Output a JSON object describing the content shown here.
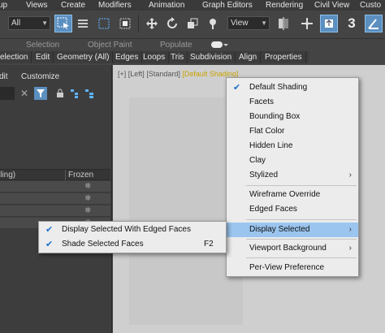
{
  "menubar": {
    "items": [
      "up",
      "Views",
      "Create",
      "Modifiers",
      "Animation",
      "Graph Editors",
      "Rendering",
      "Civil View",
      "Custo"
    ]
  },
  "toolbar": {
    "filter_value": "All",
    "viewport_dropdown_value": "View",
    "snap_label": "3"
  },
  "ribbon": {
    "labels": [
      "Selection",
      "Object Paint",
      "Populate"
    ]
  },
  "tabs": {
    "items": [
      "election",
      "Edit",
      "Geometry (All)",
      "Edges",
      "Loops",
      "Tris",
      "Subdivision",
      "Align",
      "Properties"
    ]
  },
  "left_panel": {
    "menu": [
      "dit",
      "Customize"
    ],
    "column_left": "lling)",
    "column_frozen": "Frozen",
    "row_marker": "❅"
  },
  "viewport": {
    "label_parts": [
      "[+]",
      "[Left]",
      "[Standard]"
    ],
    "shading_label": "[Default Shading]",
    "label_close": "]"
  },
  "shading_menu": {
    "items": [
      {
        "label": "Default Shading",
        "checked": true
      },
      {
        "label": "Facets"
      },
      {
        "label": "Bounding Box"
      },
      {
        "label": "Flat Color"
      },
      {
        "label": "Hidden Line"
      },
      {
        "label": "Clay"
      },
      {
        "label": "Stylized",
        "submenu": true
      },
      {
        "label": "Wireframe Override"
      },
      {
        "label": "Edged Faces"
      },
      {
        "label": "Display Selected",
        "submenu": true,
        "highlighted": true
      },
      {
        "label": "Viewport Background",
        "submenu": true
      },
      {
        "label": "Per-View Preference"
      }
    ]
  },
  "display_selected_menu": {
    "items": [
      {
        "label": "Display Selected With Edged Faces",
        "checked": true,
        "shortcut": ""
      },
      {
        "label": "Shade Selected Faces",
        "checked": true,
        "shortcut": "F2"
      }
    ]
  },
  "colors": {
    "accent": "#5b8fc0",
    "menu_bg": "#ececec",
    "highlight": "#9bc5ef",
    "checkmark": "#1e6fc8",
    "shading_label": "#c8a200"
  }
}
